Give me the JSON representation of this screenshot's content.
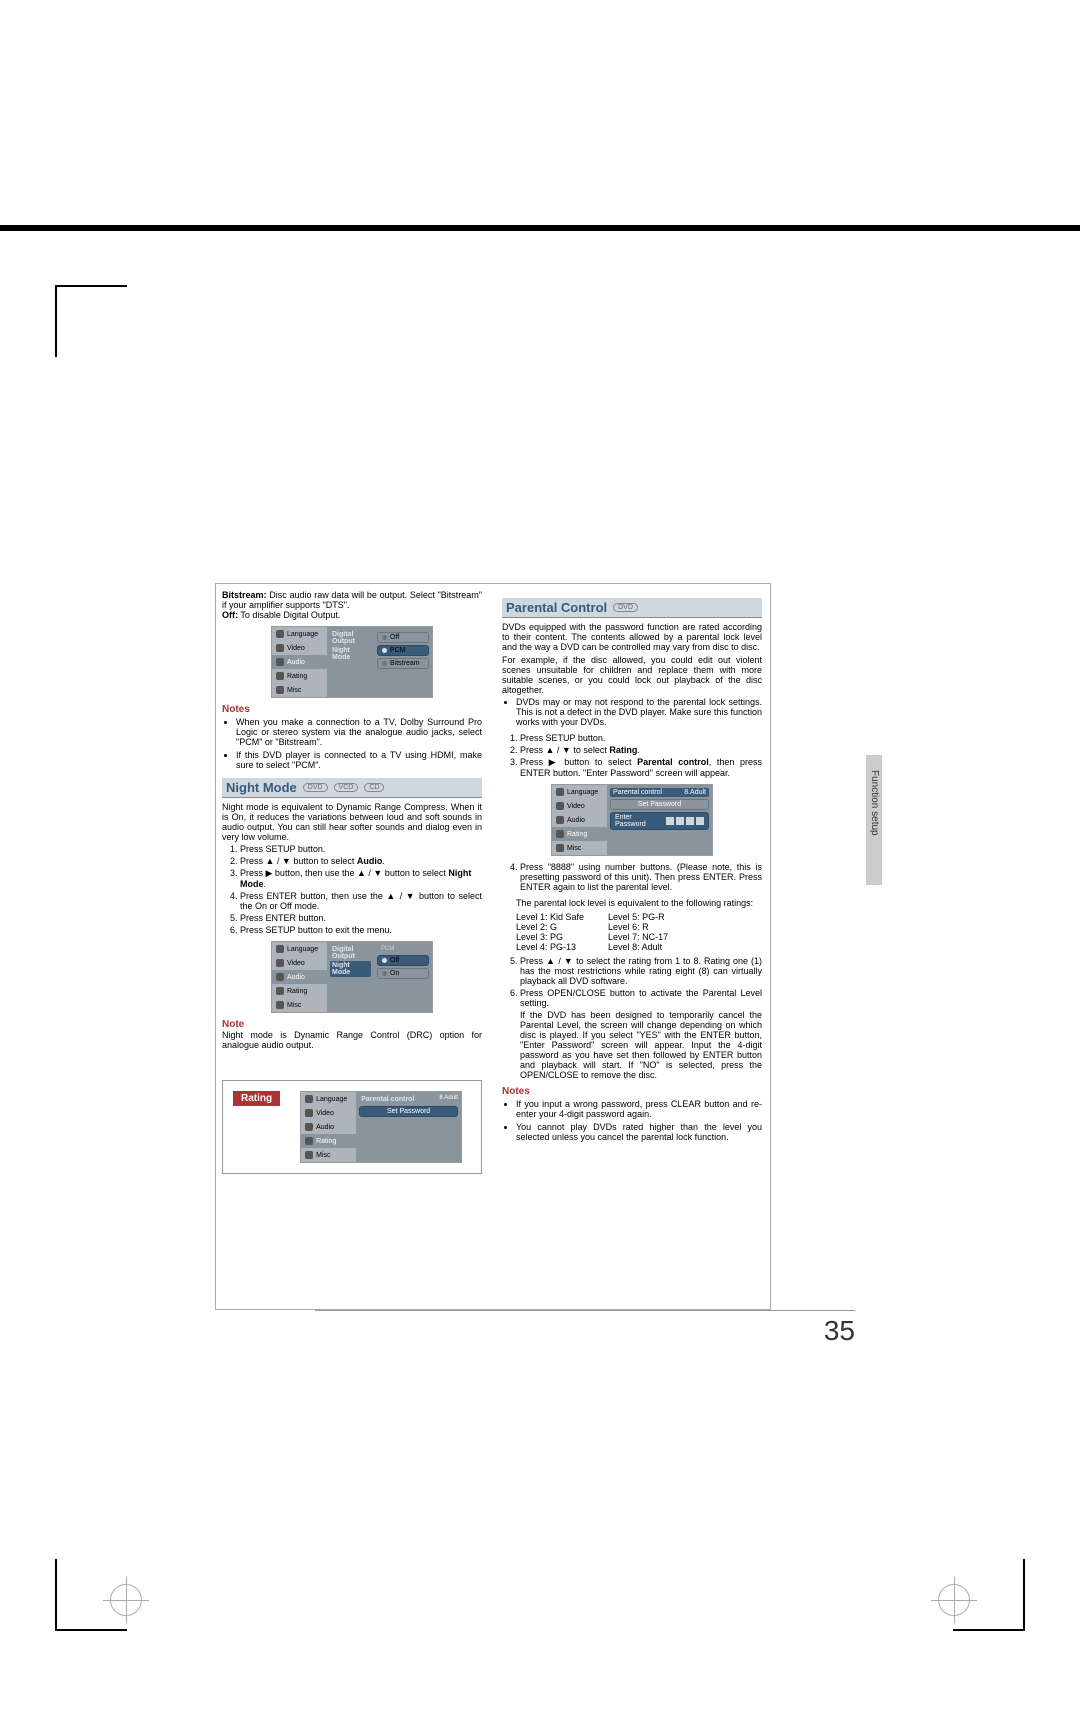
{
  "page_number": "35",
  "side_tab": "Function setup",
  "left": {
    "bitstream_para": "Bitstream: Disc audio raw data will be output. Select \"Bitstream\" if your amplifier supports \"DTS\".",
    "off_para": "Off: To disable Digital Output.",
    "notes_h": "Notes",
    "note1": "When you make a connection to a TV, Dolby Surround Pro Logic or stereo system via the analogue audio jacks, select \"PCM\" or \"Bitstream\".",
    "note2": "If this DVD player is connected to a TV using HDMI, make sure to select \"PCM\".",
    "night_h": "Night Mode",
    "night_discs": [
      "DVD",
      "VCD",
      "CD"
    ],
    "night_para": "Night mode is equivalent to Dynamic Range Compress. When it is On, it reduces the variations between loud and soft sounds in audio output. You can still hear softer sounds and dialog even in very low volume.",
    "s1": "Press SETUP button.",
    "s2a": "Press ▲ / ▼  button to select ",
    "s2b": "Audio",
    "s2c": ".",
    "s3a": "Press ▶ button, then use the ▲ / ▼ button to select ",
    "s3b": "Night Mode",
    "s3c": ".",
    "s4": "Press ENTER button, then use the ▲ / ▼ button to select the On or Off mode.",
    "s5": "Press ENTER button.",
    "s6": "Press SETUP button to exit the menu.",
    "note_h2": "Note",
    "note_bottom": "Night mode is Dynamic Range Control (DRC) option for analogue audio output.",
    "rating_tag": "Rating"
  },
  "right": {
    "pc_h": "Parental Control",
    "pc_disc": "DVD",
    "p1": "DVDs equipped with the password function are rated according to their content. The contents allowed by a parental lock level and the way a DVD can be controlled may vary from disc to disc.",
    "p2": "For example, if the disc allowed, you could edit out violent scenes unsuitable for children and replace them with more suitable scenes, or you could lock out playback of the disc altogether.",
    "b1": "DVDs may or may not respond to the parental lock settings. This is not a defect in the DVD player. Make sure this function works with your DVDs.",
    "r1": "Press SETUP button.",
    "r2a": "Press ▲ / ▼  to select ",
    "r2b": "Rating",
    "r2c": ".",
    "r3a": "Press ▶ button to select ",
    "r3b": "Parental control",
    "r3c": ", then press ENTER button. \"Enter Password\" screen will appear.",
    "r4": "Press \"8888\" using number buttons. (Please note, this is presetting password of this unit). Then press ENTER. Press ENTER again to list the parental level.",
    "lvl_intro": "The parental lock level is equivalent to the following ratings:",
    "lvl_l": [
      "Level 1: Kid Safe",
      "Level 2: G",
      "Level 3: PG",
      "Level 4: PG-13"
    ],
    "lvl_r": [
      "Level 5:  PG-R",
      "Level 6:  R",
      "Level 7:  NC-17",
      "Level 8:  Adult"
    ],
    "r5": "Press ▲ / ▼  to select the rating from 1 to 8. Rating one (1) has the most restrictions while rating eight (8) can virtually playback all DVD software.",
    "r6": "Press OPEN/CLOSE button to activate the Parental Level setting.",
    "r6b": "If the DVD has been designed to temporarily cancel the Parental Level, the screen will change depending on which disc is played. If you select \"YES\" with the ENTER button, \"Enter Password\" screen will appear. Input the 4-digit password as you have set then followed by ENTER button and playback will start. If \"NO\" is selected, press the OPEN/CLOSE to remove the disc.",
    "notes_h": "Notes",
    "nr1": "If you input a wrong password, press CLEAR button and re-enter your 4-digit password again.",
    "nr2": "You cannot play DVDs rated higher than the level you selected unless you cancel  the parental lock function."
  },
  "osd": {
    "menu": [
      "Language",
      "Video",
      "Audio",
      "Rating",
      "Misc"
    ],
    "digital_output": "Digital Output",
    "night_mode": "Night Mode",
    "off": "Off",
    "pcm": "PCM",
    "bitstream": "Bitstream",
    "on": "On",
    "parental_control": "Parental control",
    "adult": "8.Adult",
    "set_password": "Set Password",
    "enter_password": "Enter Password"
  }
}
